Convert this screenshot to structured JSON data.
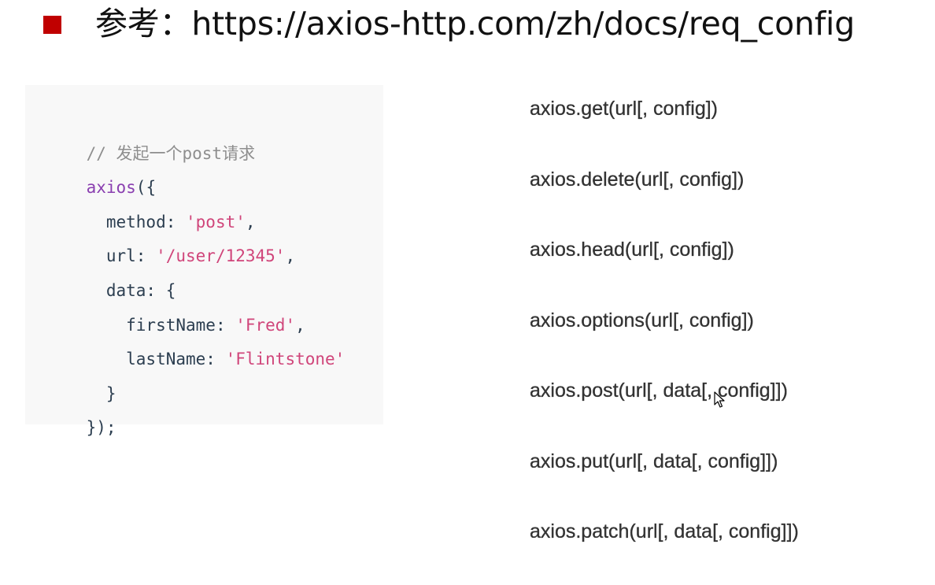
{
  "header": {
    "title": "参考：https://axios-http.com/zh/docs/req_config"
  },
  "code": {
    "lines": [
      [
        {
          "t": "comment",
          "v": "// 发起一个post请求"
        }
      ],
      [
        {
          "t": "fn",
          "v": "axios"
        },
        {
          "t": "plain",
          "v": "({"
        }
      ],
      [
        {
          "t": "plain",
          "v": "  method: "
        },
        {
          "t": "str",
          "v": "'post'"
        },
        {
          "t": "plain",
          "v": ","
        }
      ],
      [
        {
          "t": "plain",
          "v": "  url: "
        },
        {
          "t": "str",
          "v": "'/user/12345'"
        },
        {
          "t": "plain",
          "v": ","
        }
      ],
      [
        {
          "t": "plain",
          "v": "  data: {"
        }
      ],
      [
        {
          "t": "plain",
          "v": "    firstName: "
        },
        {
          "t": "str",
          "v": "'Fred'"
        },
        {
          "t": "plain",
          "v": ","
        }
      ],
      [
        {
          "t": "plain",
          "v": "    lastName: "
        },
        {
          "t": "str",
          "v": "'Flintstone'"
        }
      ],
      [
        {
          "t": "plain",
          "v": "  }"
        }
      ],
      [
        {
          "t": "plain",
          "v": "});"
        }
      ]
    ]
  },
  "methods": [
    "axios.get(url[, config])",
    "axios.delete(url[, config])",
    "axios.head(url[, config])",
    "axios.options(url[, config])",
    "axios.post(url[, data[, config]])",
    "axios.put(url[, data[, config]])",
    "axios.patch(url[, data[, config]])"
  ],
  "colors": {
    "bullet": "#c00000",
    "code_background": "#f8f8f8",
    "comment": "#8e8e8e",
    "function": "#8a3fb0",
    "string": "#d0457a",
    "plain": "#2c3e50"
  }
}
